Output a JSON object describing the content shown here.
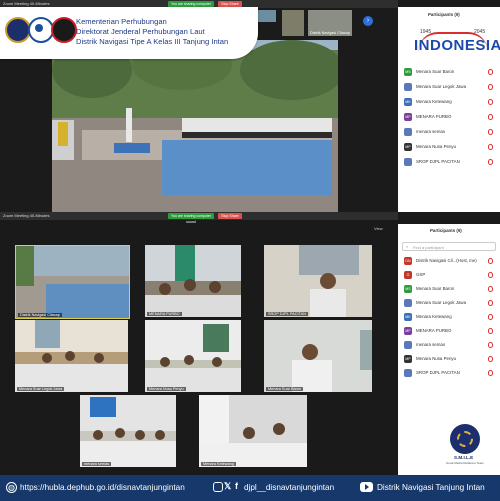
{
  "header": {
    "line1": "Kementerian Perhubungan",
    "line2": "Direktorat Jenderal Perhubungan Laut",
    "line3": "Distrik Navigasi Tipe A Kelas III Tanjung Intan"
  },
  "zoom_top": {
    "window_title": "Zoom Meeting 40-Minutes",
    "share_notice": "You are sharing computer sound",
    "stop_share": "Stop Share",
    "thumb_label": "Distrik Navigasi Cilacap",
    "panel_title": "Participants (9)",
    "participants": [
      {
        "initials": "MS",
        "name": "Menara Suar Baron",
        "color": "#2e9c3e"
      },
      {
        "initials": "",
        "name": "Menara Suar Legok Jawa",
        "color": "#5b79b8"
      },
      {
        "initials": "MK",
        "name": "Menara Ketewang",
        "color": "#3e6fb8"
      },
      {
        "initials": "MP",
        "name": "MENARA PURBO",
        "color": "#7a3e9c"
      },
      {
        "initials": "",
        "name": "menara semas",
        "color": "#5b79b8"
      },
      {
        "initials": "MP",
        "name": "Menara Nusa Penyu",
        "color": "#333333"
      },
      {
        "initials": "",
        "name": "SROP DJPL PACITAN",
        "color": "#5b79b8"
      }
    ]
  },
  "indonesia_logo": {
    "year_left": "1945",
    "word": "INDONESIA",
    "year_right": "2045"
  },
  "zoom_bottom": {
    "window_title": "Zoom Meeting 40-Minutes",
    "share_notice": "You are sharing computer sound",
    "stop_share": "Stop Share",
    "view_label": "View",
    "panel_title": "Participants (9)",
    "search_placeholder": "Find a participant",
    "tiles": [
      {
        "label": "Distrik Navigasi Cilacap"
      },
      {
        "label": "MENARA PURBO"
      },
      {
        "label": "SROP DJPL PACITAN"
      },
      {
        "label": "Menara Suar Legok Jawa"
      },
      {
        "label": "Menara Nusa Penyu"
      },
      {
        "label": "Menara Suar Baron"
      },
      {
        "label": "menara semas"
      },
      {
        "label": "Menara Ketewang"
      }
    ],
    "participants": [
      {
        "initials": "DN",
        "name": "Distrik Navigasi Cil...(Host, me)",
        "color": "#c0392b"
      },
      {
        "initials": "G",
        "name": "GSP",
        "color": "#c0392b"
      },
      {
        "initials": "MS",
        "name": "Menara Suar Baron",
        "color": "#2e9c3e"
      },
      {
        "initials": "",
        "name": "Menara Suar Legok Jawa",
        "color": "#5b79b8"
      },
      {
        "initials": "MK",
        "name": "Menara Ketewang",
        "color": "#3e6fb8"
      },
      {
        "initials": "MP",
        "name": "MENARA PURBO",
        "color": "#7a3e9c"
      },
      {
        "initials": "",
        "name": "menara semas",
        "color": "#5b79b8"
      },
      {
        "initials": "MP",
        "name": "Menara Nusa Penyu",
        "color": "#333333"
      },
      {
        "initials": "",
        "name": "SROP DJPL PACITAN",
        "color": "#5b79b8"
      }
    ]
  },
  "badge": {
    "title": "S.M.I.L.E",
    "subtitle": "Great Media Relations Team"
  },
  "footer": {
    "website": "https://hubla.dephub.go.id/disnavtanjungintan",
    "social": "djpl__disnavtanjungintan",
    "youtube": "Distrik Navigasi Tanjung Intan"
  },
  "colors": {
    "footer_bg": "#16386b",
    "title_blue": "#1f3c8a",
    "zoom_green": "#2e9c3e",
    "zoom_red": "#d9534f"
  }
}
